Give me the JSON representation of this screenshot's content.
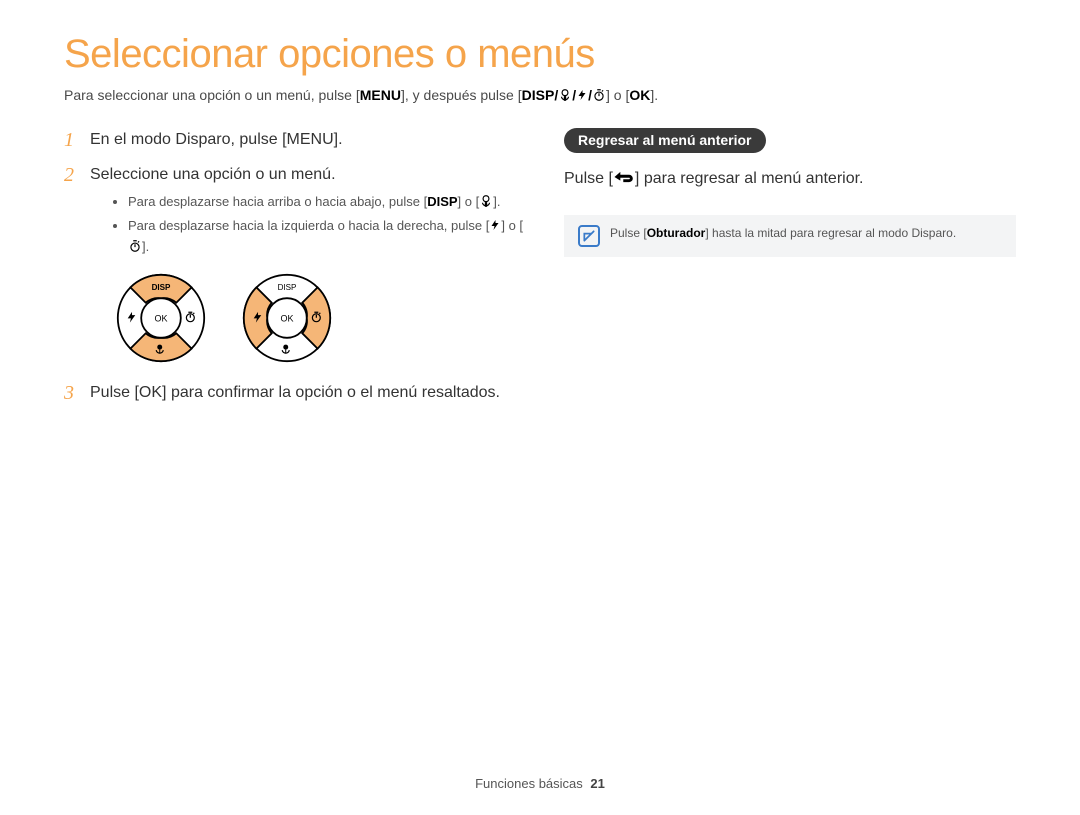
{
  "title": "Seleccionar opciones o menús",
  "intro": {
    "a": "Para seleccionar una opción o un menú, pulse [",
    "menu": "MENU",
    "b": "], y después pulse [",
    "keys": "DISP",
    "c": "/",
    "d": "/",
    "e": "/",
    "f": "] o [",
    "ok": "OK",
    "g": "]."
  },
  "steps": {
    "s1": {
      "num": "1",
      "a": "En el modo Disparo, pulse [",
      "menu": "MENU",
      "b": "]."
    },
    "s2": {
      "num": "2",
      "text": "Seleccione una opción o un menú.",
      "sub1": {
        "a": "Para desplazarse hacia arriba o hacia abajo, pulse [",
        "disp": "DISP",
        "b": "] o [",
        "c": "]."
      },
      "sub2": {
        "a": "Para desplazarse hacia la izquierda o hacia la derecha, pulse [",
        "b": "] o [",
        "c": "]."
      }
    },
    "s3": {
      "num": "3",
      "a": "Pulse [",
      "ok": "OK",
      "b": "] para confirmar la opción o el menú resaltados."
    }
  },
  "right": {
    "heading": "Regresar al menú anterior",
    "a": "Pulse [",
    "b": "] para regresar al menú anterior."
  },
  "note": {
    "a": "Pulse [",
    "key": "Obturador",
    "b": "] hasta la mitad para regresar al modo Disparo."
  },
  "dial": {
    "disp": "DISP",
    "ok": "OK"
  },
  "footer": {
    "section": "Funciones básicas",
    "page": "21"
  }
}
